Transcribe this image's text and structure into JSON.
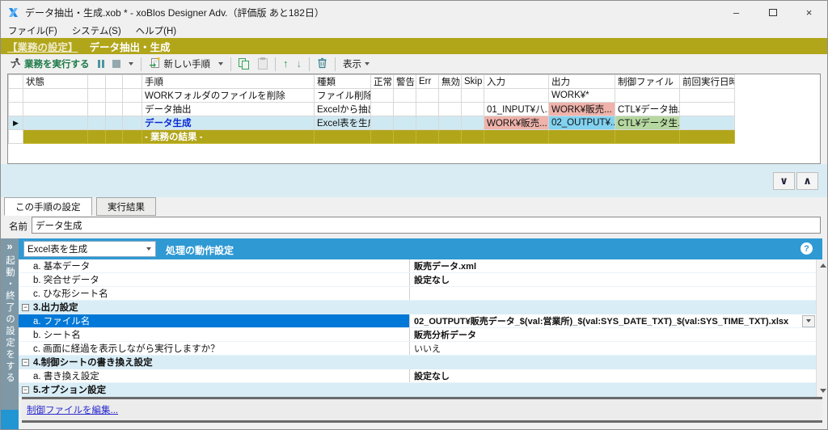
{
  "window": {
    "title": "データ抽出・生成.xob * - xoBlos Designer Adv.（評価版 あと182日）"
  },
  "menu": {
    "items": [
      {
        "label": "ファイル(F)"
      },
      {
        "label": "システム(S)"
      },
      {
        "label": "ヘルプ(H)"
      }
    ]
  },
  "banner": {
    "link": "【業務の設定】",
    "title": "データ抽出・生成"
  },
  "toolbar": {
    "run_label": "業務を実行する",
    "new_step_label": "新しい手順",
    "view_label": "表示"
  },
  "steps_table": {
    "columns": [
      "",
      "状態",
      "",
      "",
      "",
      "手順",
      "種類",
      "正常",
      "警告",
      "Err",
      "無効",
      "Skip",
      "入力",
      "出力",
      "制御ファイル",
      "前回実行日時"
    ],
    "rows": [
      {
        "status": "",
        "step": "WORKフォルダのファイルを削除",
        "type": "ファイル削除",
        "input": "",
        "output": "WORK¥*",
        "ctrl": "",
        "last_run": "",
        "selected": false,
        "step_is_link": false,
        "cell_colors": {}
      },
      {
        "status": "",
        "step": "データ抽出",
        "type": "Excelから抽出",
        "input": "01_INPUT¥八...",
        "output": "WORK¥販売...",
        "ctrl": "CTL¥データ抽...",
        "last_run": "",
        "selected": false,
        "step_is_link": false,
        "cell_colors": {
          "output": "pink"
        }
      },
      {
        "status": "",
        "step": "データ生成",
        "type": "Excel表を生成",
        "input": "WORK¥販売...",
        "output": "02_OUTPUT¥...",
        "ctrl": "CTL¥データ生...",
        "last_run": "",
        "selected": true,
        "step_is_link": true,
        "cell_colors": {
          "input": "pink",
          "output": "blue",
          "ctrl": "green"
        }
      }
    ],
    "result_row_label": "- 業務の結果 -"
  },
  "detail": {
    "tabs": [
      {
        "label": "この手順の設定",
        "active": true
      },
      {
        "label": "実行結果",
        "active": false
      }
    ],
    "name_label": "名前",
    "name_value": "データ生成",
    "action_type": "Excel表を生成",
    "panel_title": "処理の動作設定",
    "sidebar_text": "起動・終了の設定をする",
    "settings": [
      {
        "kind": "item",
        "label": "a. 基本データ",
        "value": "販売データ.xml",
        "emphasis": true
      },
      {
        "kind": "item",
        "label": "b. 突合せデータ",
        "value": "設定なし",
        "emphasis": true
      },
      {
        "kind": "item",
        "label": "c. ひな形シート名",
        "value": "",
        "emphasis": false
      },
      {
        "kind": "group",
        "label": "3.出力設定"
      },
      {
        "kind": "item",
        "label": "a. ファイル名",
        "value": "02_OUTPUT¥販売データ_$(val:営業所)_$(val:SYS_DATE_TXT)_$(val:SYS_TIME_TXT).xlsx",
        "emphasis": true,
        "selected": true,
        "has_combo": true
      },
      {
        "kind": "item",
        "label": "b. シート名",
        "value": "販売分析データ",
        "emphasis": true
      },
      {
        "kind": "item",
        "label": "c. 画面に経過を表示しながら実行しますか？",
        "value": "いいえ",
        "emphasis": false
      },
      {
        "kind": "group",
        "label": "4.制御シートの書き換え設定"
      },
      {
        "kind": "item",
        "label": "a. 書き換え設定",
        "value": "設定なし",
        "emphasis": true
      },
      {
        "kind": "group",
        "label": "5.オプション設定"
      }
    ],
    "edit_link": "制御ファイルを編集..."
  },
  "colors": {
    "accent_olive": "#b1a51a",
    "cell_pink": "#efb3ab",
    "cell_blue": "#82d2f0",
    "cell_green": "#b5d8a0",
    "selected_row": "#cfe9f2",
    "header_blue": "#2f99d3",
    "selected_item_blue": "#0078d7",
    "run_green": "#1d7a46",
    "link_blue": "#2b2bcf"
  },
  "glyphs": {
    "minimize": "–",
    "close": "×",
    "row_marker": "▶",
    "up_arrow": "↑",
    "down_arrow": "↓",
    "chevron_down": "∨",
    "chevron_up": "∧",
    "double_right": "»",
    "collapse": "−",
    "help": "?"
  }
}
